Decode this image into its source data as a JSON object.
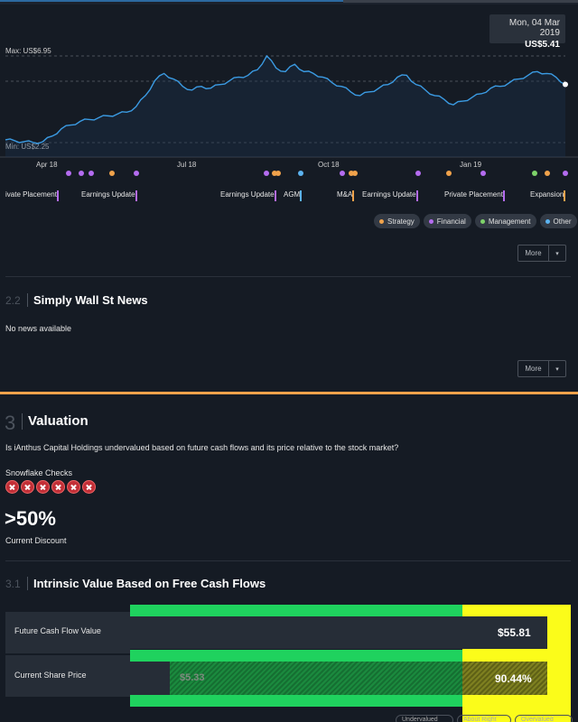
{
  "tooltip": {
    "date": "Mon, 04 Mar 2019",
    "price": "US$5.41"
  },
  "chart": {
    "max_label": "Max: US$6.95",
    "min_label": "Min: US$2.25",
    "x_labels": [
      "Apr 18",
      "Jul 18",
      "Oct 18",
      "Jan 19"
    ]
  },
  "chart_data": {
    "type": "line",
    "series": [
      {
        "values": [
          2.4,
          2.35,
          2.3,
          2.25,
          2.3,
          2.6,
          3.0,
          3.2,
          3.4,
          3.5,
          3.6,
          3.7,
          3.8,
          3.9,
          4.2,
          4.8,
          5.6,
          6.0,
          5.7,
          5.3,
          5.1,
          5.3,
          5.2,
          5.4,
          5.6,
          5.8,
          5.9,
          6.2,
          6.95,
          6.3,
          6.1,
          6.5,
          6.1,
          6.0,
          5.8,
          5.5,
          5.3,
          5.0,
          4.8,
          5.0,
          5.2,
          5.4,
          5.8,
          5.9,
          5.4,
          5.1,
          4.8,
          4.6,
          4.3,
          4.5,
          4.7,
          4.9,
          5.2,
          5.3,
          5.5,
          5.7,
          5.9,
          6.1,
          6.0,
          5.8,
          5.41
        ]
      }
    ],
    "y_min_label": "US$2.25",
    "y_max_label": "US$6.95"
  },
  "events": [
    {
      "label": "ivate Placement",
      "color": "#b46cf0"
    },
    {
      "label": "Earnings Update",
      "color": "#b46cf0"
    },
    {
      "label": "Earnings Update",
      "color": "#b46cf0"
    },
    {
      "label": "AGM",
      "color": "#5cb3f0"
    },
    {
      "label": "M&A",
      "color": "#f0a24b"
    },
    {
      "label": "Earnings Update",
      "color": "#b46cf0"
    },
    {
      "label": "Private Placement",
      "color": "#b46cf0"
    },
    {
      "label": "Expansion",
      "color": "#f0a24b"
    }
  ],
  "legend": [
    {
      "label": "Strategy",
      "color": "#f0a24b"
    },
    {
      "label": "Financial",
      "color": "#b46cf0"
    },
    {
      "label": "Management",
      "color": "#7ed36a"
    },
    {
      "label": "Other",
      "color": "#5cb3f0"
    }
  ],
  "buttons": {
    "more": "More",
    "caret": "▾"
  },
  "news": {
    "num": "2.2",
    "title": "Simply Wall St News",
    "empty": "No news available"
  },
  "valuation": {
    "num": "3",
    "title": "Valuation",
    "question": "Is iAnthus Capital Holdings undervalued based on future cash flows and its price relative to the stock market?",
    "snowflake_label": "Snowflake Checks",
    "discount": ">50%",
    "discount_label": "Current Discount"
  },
  "intrinsic": {
    "num": "3.1",
    "title": "Intrinsic Value Based on Free Cash Flows",
    "future_label": "Future Cash Flow Value",
    "future_value": "$55.81",
    "price_label": "Current Share Price",
    "price_value": "$5.33",
    "pct": "90.44%"
  },
  "bottom_buttons": [
    "Undervalued",
    "About Right",
    "Overvalued"
  ]
}
